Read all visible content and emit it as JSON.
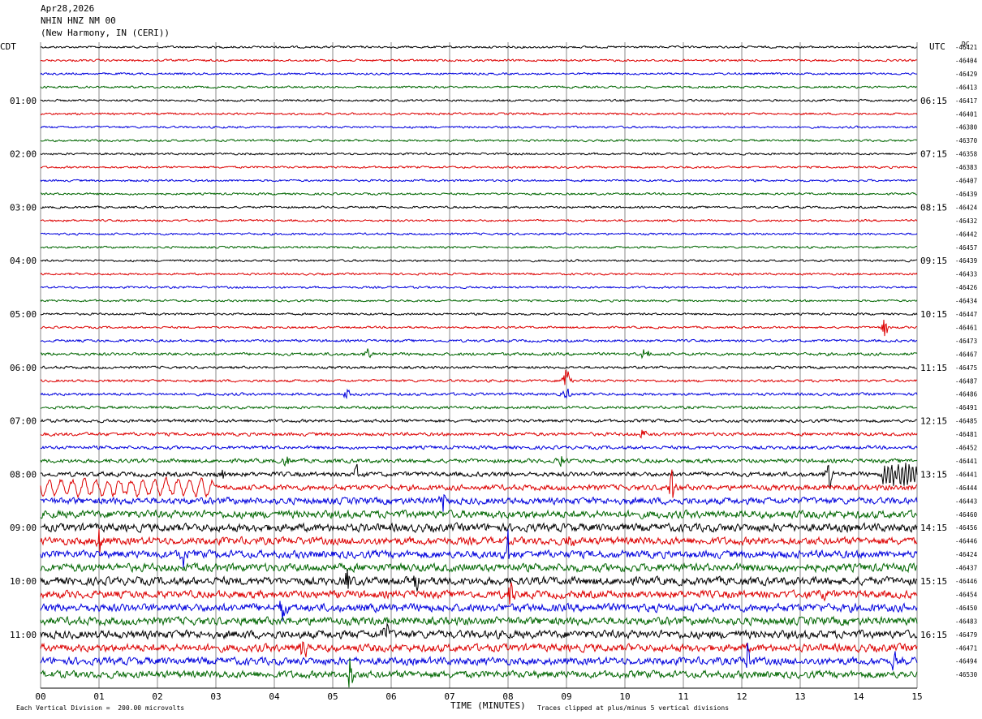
{
  "header": {
    "date": "Apr28,2026",
    "station": "NHIN HNZ NM 00",
    "location": "(New Harmony, IN (CERI))"
  },
  "left_label": "CDT",
  "right_label": "UTC",
  "dc_label": "DC",
  "footer": {
    "scale": "Each Vertical Division =  200.00 microvolts",
    "xlabel": "TIME (MINUTES)",
    "clip_note": "Traces clipped at plus/minus 5 vertical divisions"
  },
  "colors": {
    "trace_cycle": [
      "#000000",
      "#dd0000",
      "#0000dd",
      "#006600"
    ],
    "grid": "#888888"
  },
  "chart_data": {
    "type": "line",
    "xlabel": "TIME (MINUTES)",
    "xlim": [
      0,
      15
    ],
    "x_ticks": [
      "00",
      "01",
      "02",
      "03",
      "04",
      "05",
      "06",
      "07",
      "08",
      "09",
      "10",
      "11",
      "12",
      "13",
      "14",
      "15"
    ],
    "left_hour_labels": [
      {
        "row": 4,
        "label": "01:00"
      },
      {
        "row": 8,
        "label": "02:00"
      },
      {
        "row": 12,
        "label": "03:00"
      },
      {
        "row": 16,
        "label": "04:00"
      },
      {
        "row": 20,
        "label": "05:00"
      },
      {
        "row": 24,
        "label": "06:00"
      },
      {
        "row": 28,
        "label": "07:00"
      },
      {
        "row": 32,
        "label": "08:00"
      },
      {
        "row": 36,
        "label": "09:00"
      },
      {
        "row": 40,
        "label": "10:00"
      },
      {
        "row": 44,
        "label": "11:00"
      }
    ],
    "right_hour_labels": [
      {
        "row": 4,
        "label": "06:15"
      },
      {
        "row": 8,
        "label": "07:15"
      },
      {
        "row": 12,
        "label": "08:15"
      },
      {
        "row": 16,
        "label": "09:15"
      },
      {
        "row": 20,
        "label": "10:15"
      },
      {
        "row": 24,
        "label": "11:15"
      },
      {
        "row": 28,
        "label": "12:15"
      },
      {
        "row": 32,
        "label": "13:15"
      },
      {
        "row": 36,
        "label": "14:15"
      },
      {
        "row": 40,
        "label": "15:15"
      },
      {
        "row": 44,
        "label": "16:15"
      }
    ],
    "dc_offsets": [
      "-46421",
      "-46404",
      "-46429",
      "-46413",
      "-46417",
      "-46401",
      "-46380",
      "-46370",
      "-46358",
      "-46383",
      "-46407",
      "-46439",
      "-46424",
      "-46432",
      "-46442",
      "-46457",
      "-46439",
      "-46433",
      "-46426",
      "-46434",
      "-46447",
      "-46461",
      "-46473",
      "-46467",
      "-46475",
      "-46487",
      "-46486",
      "-46491",
      "-46485",
      "-46481",
      "-46452",
      "-46441",
      "-46441",
      "-46444",
      "-46443",
      "-46460",
      "-46456",
      "-46446",
      "-46424",
      "-46437",
      "-46446",
      "-46454",
      "-46450",
      "-46483",
      "-46479",
      "-46471",
      "-46494",
      "-46530"
    ],
    "trace_activity": [
      1,
      1,
      1,
      1,
      1,
      1,
      1,
      1,
      1,
      1,
      1,
      1,
      1,
      1,
      1,
      1,
      1,
      1,
      1,
      1,
      1,
      1,
      1.2,
      1.4,
      1.2,
      1.2,
      1.3,
      1.3,
      1.5,
      1.6,
      1.6,
      1.9,
      2.2,
      2.6,
      3.2,
      3.6,
      3.8,
      3.6,
      3.6,
      3.8,
      3.8,
      3.6,
      3.8,
      3.8,
      3.8,
      3.6,
      3.6,
      3.4
    ],
    "events": [
      {
        "row": 21,
        "minute": 14.45,
        "amp": 18
      },
      {
        "row": 23,
        "minute": 5.6,
        "amp": 8
      },
      {
        "row": 23,
        "minute": 10.35,
        "amp": 14
      },
      {
        "row": 25,
        "minute": 9.0,
        "amp": 30
      },
      {
        "row": 26,
        "minute": 9.0,
        "amp": 16
      },
      {
        "row": 26,
        "minute": 5.25,
        "amp": 10
      },
      {
        "row": 29,
        "minute": 10.3,
        "amp": 10
      },
      {
        "row": 31,
        "minute": 4.2,
        "amp": 12
      },
      {
        "row": 31,
        "minute": 8.9,
        "amp": 10
      },
      {
        "row": 32,
        "minute": 3.1,
        "amp": 12
      },
      {
        "row": 32,
        "minute": 5.4,
        "amp": 16
      },
      {
        "row": 32,
        "minute": 13.5,
        "amp": 24
      },
      {
        "row": 32,
        "minute": 14.65,
        "amp": 16
      },
      {
        "row": 33,
        "minute": 10.8,
        "amp": 30
      },
      {
        "row": 34,
        "minute": 6.9,
        "amp": 16
      },
      {
        "row": 37,
        "minute": 1.0,
        "amp": 18
      },
      {
        "row": 37,
        "minute": 9.05,
        "amp": 18
      },
      {
        "row": 38,
        "minute": 2.45,
        "amp": 20
      },
      {
        "row": 38,
        "minute": 8.0,
        "amp": 30
      },
      {
        "row": 40,
        "minute": 5.25,
        "amp": 26
      },
      {
        "row": 40,
        "minute": 6.45,
        "amp": 22
      },
      {
        "row": 41,
        "minute": 8.05,
        "amp": 26
      },
      {
        "row": 41,
        "minute": 13.4,
        "amp": 16
      },
      {
        "row": 42,
        "minute": 4.15,
        "amp": 26
      },
      {
        "row": 44,
        "minute": 5.9,
        "amp": 24
      },
      {
        "row": 45,
        "minute": 4.5,
        "amp": 34
      },
      {
        "row": 46,
        "minute": 12.1,
        "amp": 26
      },
      {
        "row": 46,
        "minute": 14.6,
        "amp": 22
      },
      {
        "row": 47,
        "minute": 5.3,
        "amp": 34
      }
    ],
    "sinusoid_segments": [
      {
        "row": 32,
        "start": 14.4,
        "end": 15.0,
        "amp": 12,
        "period": 0.06
      },
      {
        "row": 33,
        "start": 0.0,
        "end": 3.0,
        "amp": 9,
        "period": 0.2
      }
    ]
  }
}
